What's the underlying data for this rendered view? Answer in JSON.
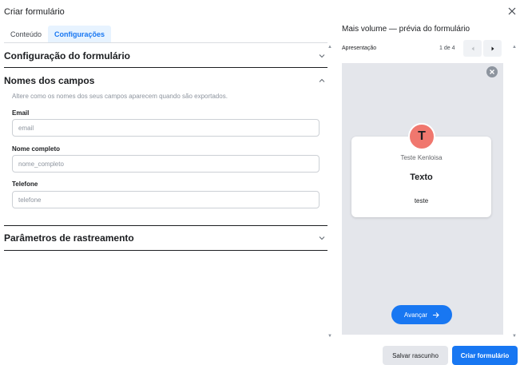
{
  "dialog": {
    "title": "Criar formulário",
    "close_icon": "close-icon"
  },
  "tabs": [
    {
      "label": "Conteúdo",
      "active": false
    },
    {
      "label": "Configurações",
      "active": true
    }
  ],
  "sections": {
    "form_config": {
      "title": "Configuração do formulário",
      "expanded": false
    },
    "field_names": {
      "title": "Nomes dos campos",
      "expanded": true,
      "help": "Altere como os nomes dos seus campos aparecem quando são exportados.",
      "fields": [
        {
          "label": "Email",
          "placeholder": "email"
        },
        {
          "label": "Nome completo",
          "placeholder": "nome_completo"
        },
        {
          "label": "Telefone",
          "placeholder": "telefone"
        }
      ]
    },
    "tracking": {
      "title": "Parâmetros de rastreamento",
      "expanded": false
    }
  },
  "preview": {
    "title": "Mais volume — prévia do formulário",
    "section_label": "Apresentação",
    "pager": "1 de 4",
    "card": {
      "avatar_letter": "T",
      "name": "Teste Kenloisa",
      "title": "Texto",
      "body": "teste"
    },
    "next_label": "Avançar"
  },
  "footer": {
    "save_draft": "Salvar rascunho",
    "create": "Criar formulário"
  },
  "colors": {
    "accent": "#1877f2",
    "avatar": "#f0776e",
    "preview_bg": "#e4e6eb"
  }
}
